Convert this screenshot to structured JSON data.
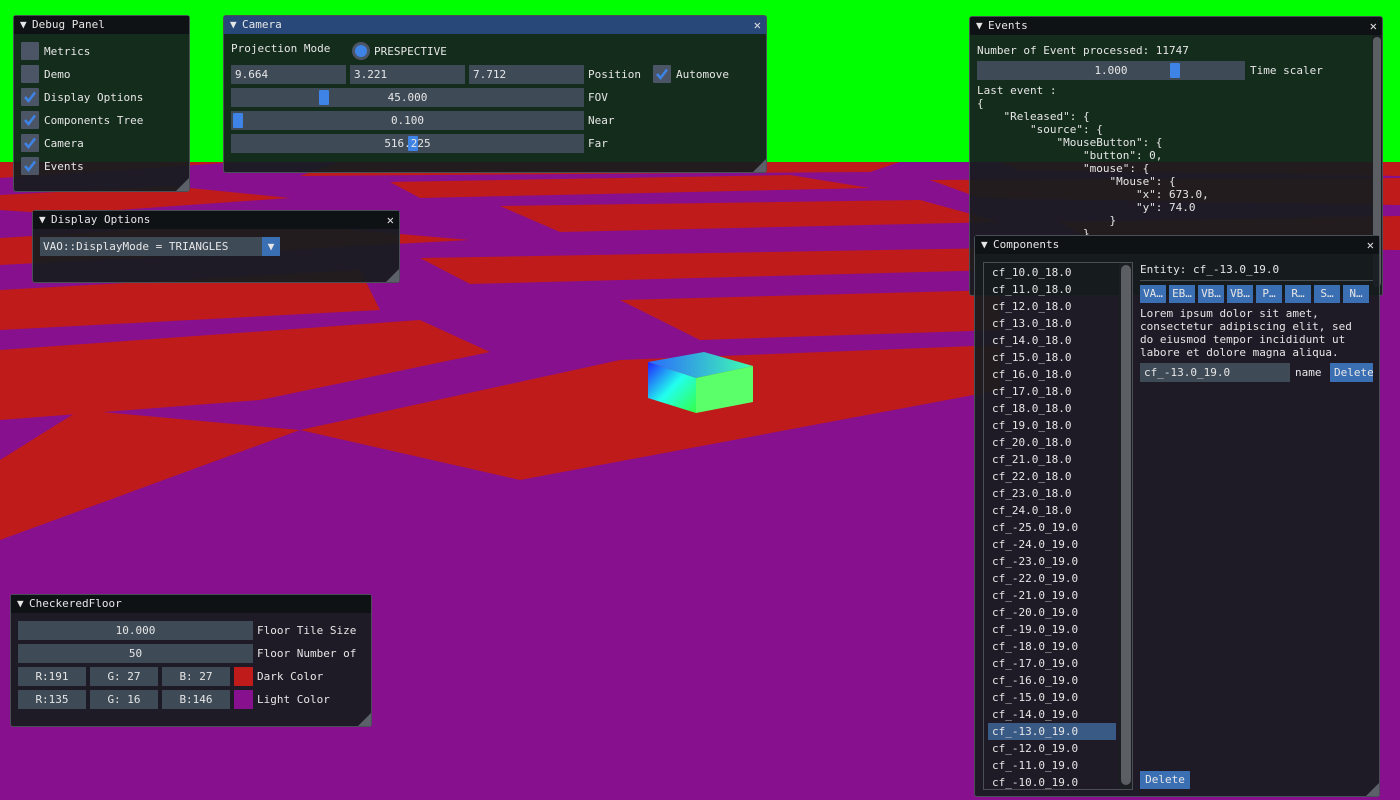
{
  "colors": {
    "sky": "#00ff00",
    "floor_red": "#bf1b1b",
    "floor_purple": "#87108f",
    "accent": "#3d84e6"
  },
  "debug_panel": {
    "title": "Debug Panel",
    "items": [
      {
        "label": "Metrics",
        "checked": false
      },
      {
        "label": "Demo",
        "checked": false
      },
      {
        "label": "Display Options",
        "checked": true
      },
      {
        "label": "Components Tree",
        "checked": true
      },
      {
        "label": "Camera",
        "checked": true
      },
      {
        "label": "Events",
        "checked": true
      }
    ]
  },
  "camera": {
    "title": "Camera",
    "projection_label": "Projection Mode",
    "projection_value": "PRESPECTIVE",
    "position": [
      "9.664",
      "3.221",
      "7.712"
    ],
    "position_label": "Position",
    "automove_label": "Automove",
    "automove_checked": true,
    "fov": {
      "value": "45.000",
      "label": "FOV",
      "fraction": 0.25
    },
    "near": {
      "value": "0.100",
      "label": "Near",
      "fraction": 0.0
    },
    "far": {
      "value": "516.225",
      "label": "Far",
      "fraction": 0.5
    }
  },
  "display_options": {
    "title": "Display Options",
    "combo_value": "VAO::DisplayMode = TRIANGLES"
  },
  "events": {
    "title": "Events",
    "count_text": "Number of Event processed: 11747",
    "time_scaler_value": "1.000",
    "time_scaler_label": "Time scaler",
    "time_scaler_fraction": 0.72,
    "last_event_label": "Last event :",
    "json_lines": [
      "{",
      "    \"Released\": {",
      "        \"source\": {",
      "            \"MouseButton\": {",
      "                \"button\": 0,",
      "                \"mouse\": {",
      "                    \"Mouse\": {",
      "                        \"x\": 673.0,",
      "                        \"y\": 74.0",
      "                    }",
      "                }"
    ]
  },
  "components": {
    "title": "Components",
    "entity_label": "Entity: cf_-13.0_19.0",
    "component_buttons": [
      "VA…",
      "EB…",
      "VB…",
      "VB…",
      "P…",
      "R…",
      "S…",
      "N…"
    ],
    "lorem": [
      "Lorem ipsum dolor sit amet,",
      "consectetur adipiscing elit, sed",
      "do eiusmod tempor incididunt ut",
      "labore et dolore magna aliqua."
    ],
    "name_value": "cf_-13.0_19.0",
    "name_label": "name",
    "delete_inline": "Delete",
    "delete_bottom": "Delete",
    "selected_index": 27,
    "entities": [
      "cf_10.0_18.0",
      "cf_11.0_18.0",
      "cf_12.0_18.0",
      "cf_13.0_18.0",
      "cf_14.0_18.0",
      "cf_15.0_18.0",
      "cf_16.0_18.0",
      "cf_17.0_18.0",
      "cf_18.0_18.0",
      "cf_19.0_18.0",
      "cf_20.0_18.0",
      "cf_21.0_18.0",
      "cf_22.0_18.0",
      "cf_23.0_18.0",
      "cf_24.0_18.0",
      "cf_-25.0_19.0",
      "cf_-24.0_19.0",
      "cf_-23.0_19.0",
      "cf_-22.0_19.0",
      "cf_-21.0_19.0",
      "cf_-20.0_19.0",
      "cf_-19.0_19.0",
      "cf_-18.0_19.0",
      "cf_-17.0_19.0",
      "cf_-16.0_19.0",
      "cf_-15.0_19.0",
      "cf_-14.0_19.0",
      "cf_-13.0_19.0",
      "cf_-12.0_19.0",
      "cf_-11.0_19.0",
      "cf_-10.0_19.0"
    ]
  },
  "checkered_floor": {
    "title": "CheckeredFloor",
    "tile_size_value": "10.000",
    "tile_size_label": "Floor Tile Size",
    "number_value": "50",
    "number_label": "Floor Number of",
    "dark": {
      "r": "R:191",
      "g": "G: 27",
      "b": "B: 27",
      "label": "Dark Color",
      "swatch": "#bf1b1b"
    },
    "light": {
      "r": "R:135",
      "g": "G: 16",
      "b": "B:146",
      "label": "Light Color",
      "swatch": "#87108f"
    }
  }
}
